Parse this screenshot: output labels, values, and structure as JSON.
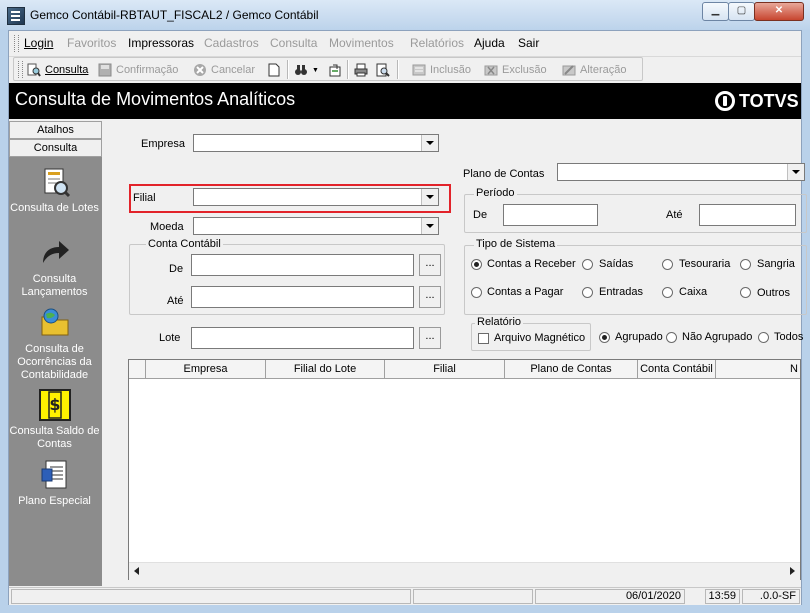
{
  "window": {
    "title": "Gemco Contábil-RBTAUT_FISCAL2 / Gemco Contábil"
  },
  "menu": {
    "items": [
      "Login",
      "Favoritos",
      "Impressoras",
      "Cadastros",
      "Consulta",
      "Movimentos",
      "Relatórios",
      "Ajuda",
      "Sair"
    ]
  },
  "toolbar": {
    "consulta": "Consulta",
    "confirmacao": "Confirmação",
    "cancelar": "Cancelar",
    "inclusao": "Inclusão",
    "exclusao": "Exclusão",
    "alteracao": "Alteração"
  },
  "header": {
    "title": "Consulta de Movimentos Analíticos",
    "logo": "TOTVS"
  },
  "sidebar": {
    "tabs": [
      "Atalhos",
      "Consulta"
    ],
    "items": [
      {
        "label": "Consulta de Lotes",
        "icon": "lotes-document-icon"
      },
      {
        "label": "Consulta Lançamentos",
        "icon": "curved-arrow-icon"
      },
      {
        "label": "Consulta de Ocorrências da Contabilidade",
        "icon": "folder-globe-icon"
      },
      {
        "label": "Consulta Saldo de Contas",
        "icon": "money-calculator-icon"
      },
      {
        "label": "Plano Especial",
        "icon": "document-list-icon"
      }
    ]
  },
  "form": {
    "empresa_label": "Empresa",
    "empresa_value": "",
    "filial_label": "Filial",
    "filial_value": "",
    "moeda_label": "Moeda",
    "moeda_value": "",
    "conta_contabil_label": "Conta Contábil",
    "de_label": "De",
    "ate_label": "Até",
    "lote_label": "Lote",
    "ellipsis": "...",
    "plano_contas_label": "Plano de Contas",
    "plano_contas_value": "",
    "periodo_label": "Período",
    "periodo_de_label": "De",
    "periodo_ate_label": "Até",
    "tipo_sistema_label": "Tipo de Sistema",
    "tipo_sistema_options": [
      "Contas a Receber",
      "Saídas",
      "Tesouraria",
      "Sangria",
      "Contas a Pagar",
      "Entradas",
      "Caixa",
      "Outros"
    ],
    "tipo_sistema_selected": "Contas a Receber",
    "relatorio_label": "Relatório",
    "arquivo_magnetico_label": "Arquivo Magnético",
    "agrupamento_options": [
      "Agrupado",
      "Não Agrupado",
      "Todos"
    ],
    "agrupamento_selected": "Agrupado"
  },
  "grid": {
    "columns": [
      "Empresa",
      "Filial do Lote",
      "Filial",
      "Plano de Contas",
      "Conta Contábil",
      "N"
    ]
  },
  "status": {
    "date": "06/01/2020",
    "time": "13:59",
    "version": ".0.0-SF"
  }
}
